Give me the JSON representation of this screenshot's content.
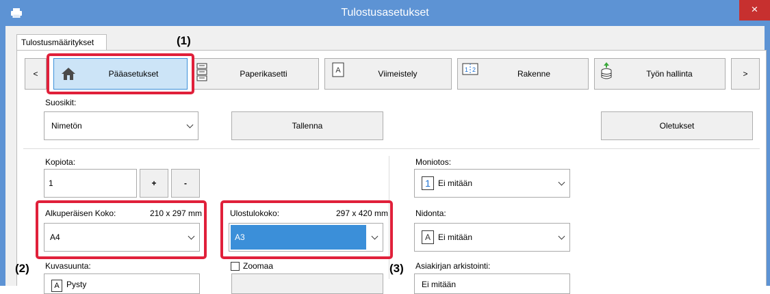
{
  "window": {
    "title": "Tulostusasetukset",
    "close_label": "×"
  },
  "tab": {
    "label": "Tulostusmääritykset"
  },
  "nav": {
    "prev_label": "<",
    "next_label": ">",
    "items": [
      {
        "label": "Pääasetukset",
        "icon": "home-icon",
        "selected": true
      },
      {
        "label": "Paperikasetti",
        "icon": "paper-tray-icon"
      },
      {
        "label": "Viimeistely",
        "icon": "finishing-icon"
      },
      {
        "label": "Rakenne",
        "icon": "layout-icon"
      },
      {
        "label": "Työn hallinta",
        "icon": "job-control-icon"
      }
    ]
  },
  "favorites": {
    "label": "Suosikit:",
    "value": "Nimetön",
    "save_label": "Tallenna",
    "defaults_label": "Oletukset"
  },
  "copies": {
    "label": "Kopiota:",
    "value": "1",
    "plus": "+",
    "minus": "-"
  },
  "original_size": {
    "label": "Alkuperäisen Koko:",
    "dims": "210 x 297 mm",
    "value": "A4"
  },
  "output_size": {
    "label": "Ulostulokoko:",
    "dims": "297 x 420 mm",
    "value": "A3"
  },
  "n_up": {
    "label": "Moniotos:",
    "icon_text": "1",
    "value": "Ei mitään"
  },
  "binding": {
    "label": "Nidonta:",
    "icon_text": "A",
    "value": "Ei mitään"
  },
  "orientation": {
    "label": "Kuvasuunta:",
    "icon_text": "A",
    "value": "Pysty"
  },
  "zoom": {
    "label": "Zoomaa",
    "checked": false
  },
  "archive": {
    "label": "Asiakirjan arkistointi:",
    "value": "Ei mitään"
  },
  "annotations": {
    "a1": "(1)",
    "a2": "(2)",
    "a3": "(3)"
  },
  "colors": {
    "titlebar": "#5d93d4",
    "close": "#c7302f",
    "highlight": "#e0203a",
    "selected_field": "#3b8fd9"
  }
}
